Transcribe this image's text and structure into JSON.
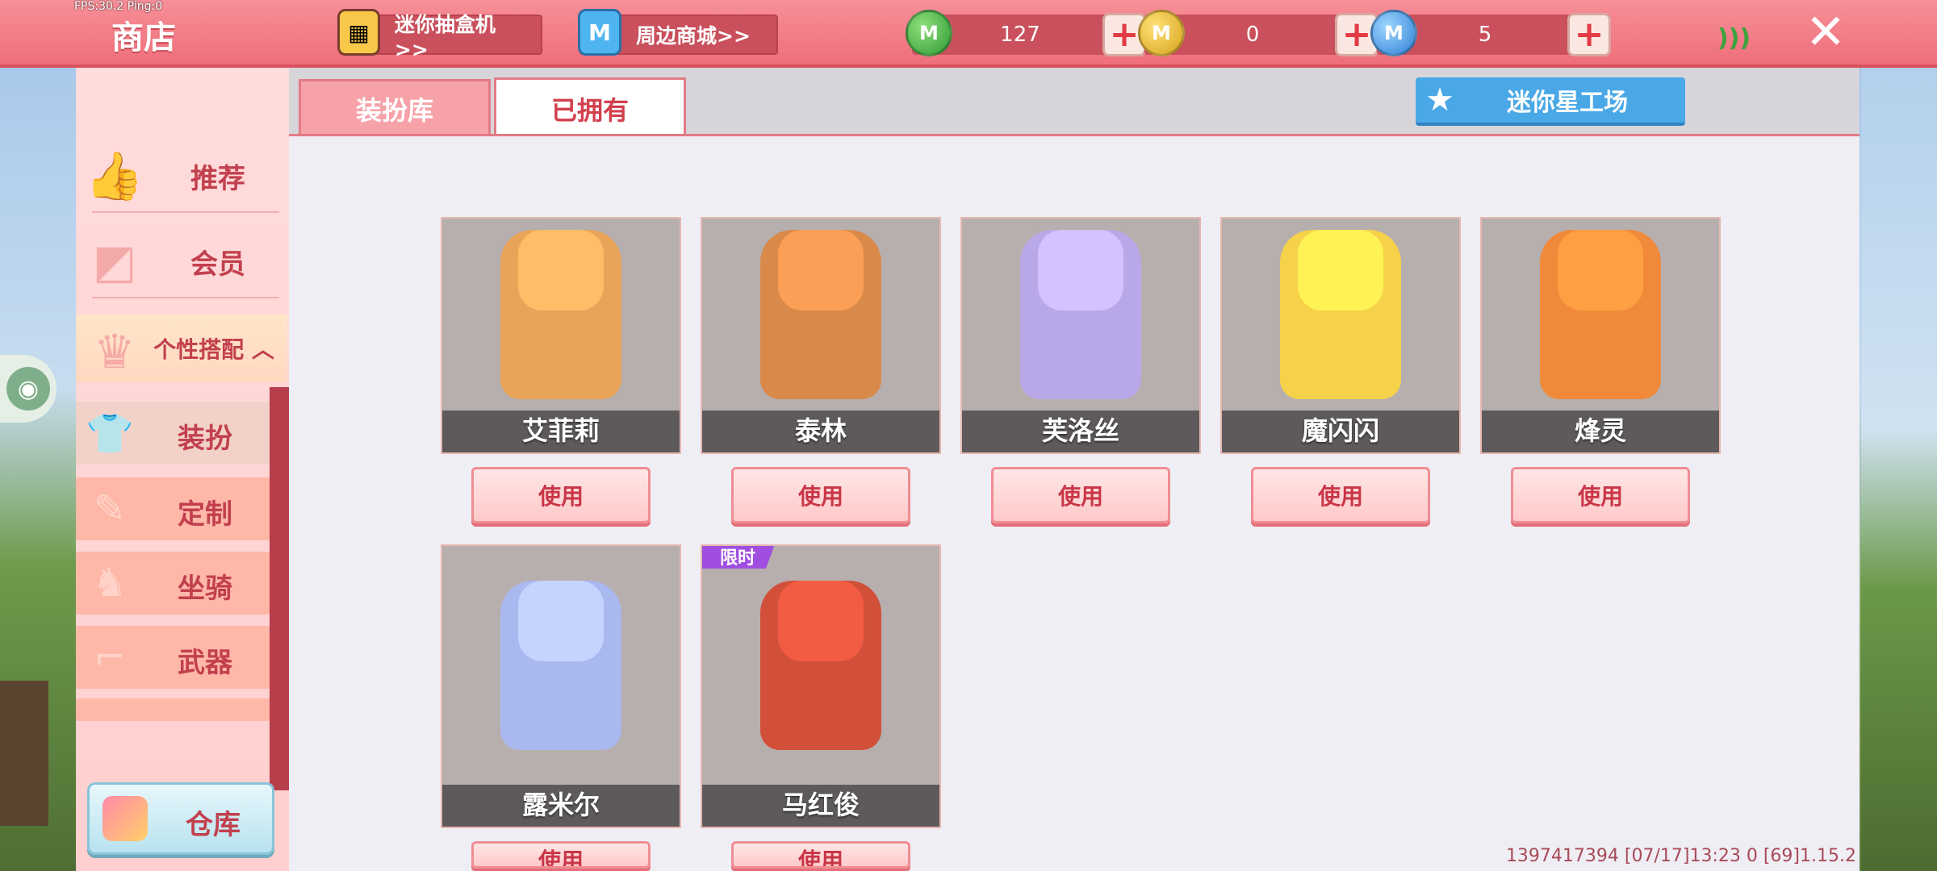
{
  "hud": {
    "fps": "FPS:30.2  Ping:0"
  },
  "header": {
    "title": "商店",
    "lottery_label": "迷你抽盒机>>",
    "mall_label": "周边商城>>",
    "currencies": [
      {
        "amount": "127",
        "color": "#2e9a36",
        "icon": "green-coin-icon"
      },
      {
        "amount": "0",
        "color": "#d7a21a",
        "icon": "gold-coin-icon"
      },
      {
        "amount": "5",
        "color": "#2f7fd6",
        "icon": "blue-coin-icon"
      }
    ],
    "plus": "+",
    "close": "✕"
  },
  "sidebar": {
    "recommend": "推荐",
    "vip": "会员",
    "personalize": "个性搭配 ︿",
    "sub": {
      "dress": "装扮",
      "customize": "定制",
      "mount": "坐骑",
      "weapon": "武器"
    },
    "warehouse": "仓库"
  },
  "tabs": {
    "dress_library": "装扮库",
    "owned": "已拥有"
  },
  "studio_button": "迷你星工场",
  "use_label": "使用",
  "skins": [
    {
      "name": "艾菲莉",
      "color": "#e9a45a"
    },
    {
      "name": "泰林",
      "color": "#d98a4a"
    },
    {
      "name": "芙洛丝",
      "color": "#b9a8e8"
    },
    {
      "name": "魔闪闪",
      "color": "#f6d24a"
    },
    {
      "name": "烽灵",
      "color": "#f08a3a"
    },
    {
      "name": "露米尔",
      "color": "#aab8f0"
    },
    {
      "name": "马红俊",
      "color": "#d2503a",
      "tag": "限时"
    }
  ],
  "footer": "1397417394   [07/17]13:23 0   [69]1.15.2",
  "colors": {
    "accent": "#ee6f7b",
    "brand_red": "#c2404e",
    "studio_blue": "#4aa8e6"
  }
}
